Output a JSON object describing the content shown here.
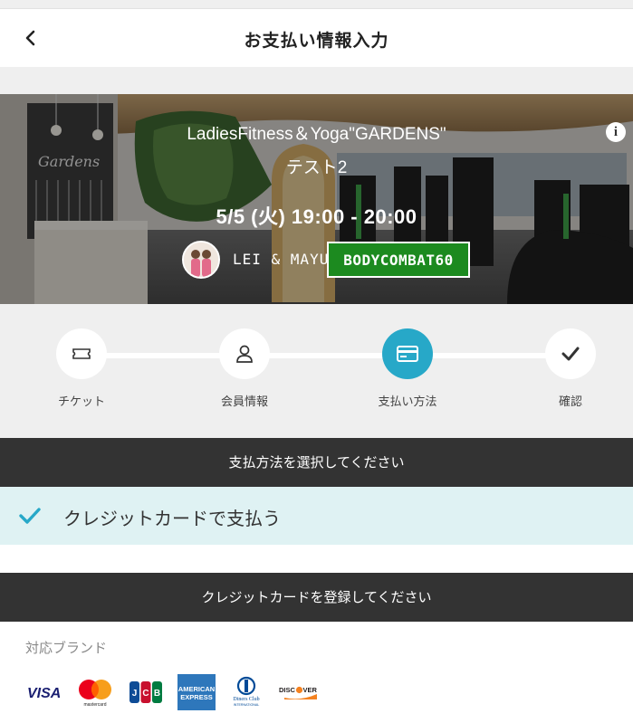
{
  "header": {
    "title": "お支払い情報入力",
    "back_icon": "chevron-left-icon"
  },
  "lesson": {
    "name": "LadiesFitness＆Yoga\"GARDENS\"",
    "subtitle": "テスト2",
    "datetime": "5/5 (火) 19:00 - 20:00",
    "instructor": "LEI & MAYU",
    "program": "BODYCOMBAT60",
    "program_color": "#1c8a1f",
    "studio_sign": "Gardens",
    "info_icon": "info-icon"
  },
  "steps": [
    {
      "label": "チケット",
      "icon": "ticket-icon",
      "active": false
    },
    {
      "label": "会員情報",
      "icon": "user-icon",
      "active": false
    },
    {
      "label": "支払い方法",
      "icon": "credit-card-icon",
      "active": true
    },
    {
      "label": "確認",
      "icon": "check-icon",
      "active": false
    }
  ],
  "accent_color": "#27a8c8",
  "payment": {
    "select_heading": "支払方法を選択してください",
    "selected_method": "クレジットカードで支払う",
    "register_heading": "クレジットカードを登録してください",
    "brands_title": "対応ブランド",
    "brands": [
      {
        "name": "VISA",
        "icon": "visa-icon"
      },
      {
        "name": "mastercard",
        "icon": "mastercard-icon"
      },
      {
        "name": "JCB",
        "icon": "jcb-icon"
      },
      {
        "name": "AMERICAN EXPRESS",
        "icon": "amex-icon"
      },
      {
        "name": "Diners Club INTERNATIONAL",
        "icon": "diners-icon"
      },
      {
        "name": "DISCOVER",
        "icon": "discover-icon"
      }
    ]
  }
}
